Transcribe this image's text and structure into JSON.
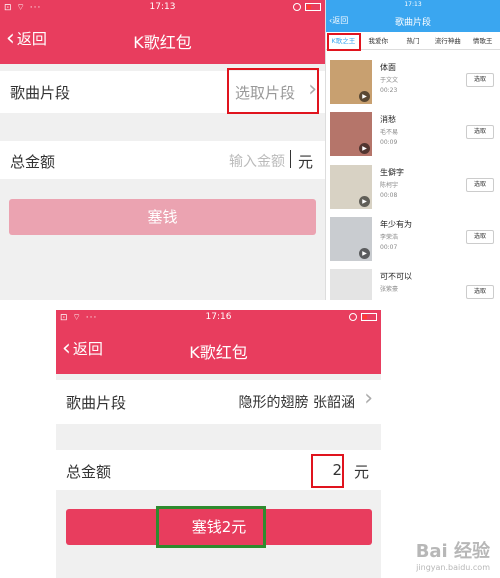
{
  "panel1": {
    "status": {
      "left": "⊡ ⌔ ···",
      "time": "17:13"
    },
    "nav": {
      "back": "返回",
      "title": "K歌红包"
    },
    "song_row": {
      "label": "歌曲片段",
      "value": "选取片段"
    },
    "amount_row": {
      "label": "总金额",
      "placeholder": "输入金额",
      "unit": "元"
    },
    "submit": {
      "label": "塞钱"
    }
  },
  "panel2": {
    "status": {
      "time": "17:13"
    },
    "nav": {
      "back": "返回",
      "title": "歌曲片段"
    },
    "tabs": [
      "K歌之王",
      "我爱你",
      "热门",
      "流行神曲",
      "情歌王"
    ],
    "pick_label": "选取",
    "songs": [
      {
        "name": "体面",
        "artist": "于文文",
        "duration": "00:23"
      },
      {
        "name": "消愁",
        "artist": "毛不易",
        "duration": "00:09"
      },
      {
        "name": "生僻字",
        "artist": "陈柯宇",
        "duration": "00:08"
      },
      {
        "name": "年少有为",
        "artist": "李荣浩",
        "duration": "00:07"
      },
      {
        "name": "可不可以",
        "artist": "张紫豪",
        "duration": ""
      }
    ]
  },
  "panel3": {
    "status": {
      "left": "⊡ ⌔ ···",
      "time": "17:16"
    },
    "nav": {
      "back": "返回",
      "title": "K歌红包"
    },
    "song_row": {
      "label": "歌曲片段",
      "value": "隐形的翅膀 张韶涵"
    },
    "amount_row": {
      "label": "总金额",
      "value": "2",
      "unit": "元"
    },
    "submit": {
      "label": "塞钱2元"
    }
  },
  "watermark": {
    "text": "Bai 经验",
    "sub": "jingyan.baidu.com"
  },
  "colors": {
    "brand": "#e83d5e",
    "blue": "#3aa6f0",
    "highlight_red": "#e0141e",
    "highlight_green": "#2e8b2e"
  }
}
